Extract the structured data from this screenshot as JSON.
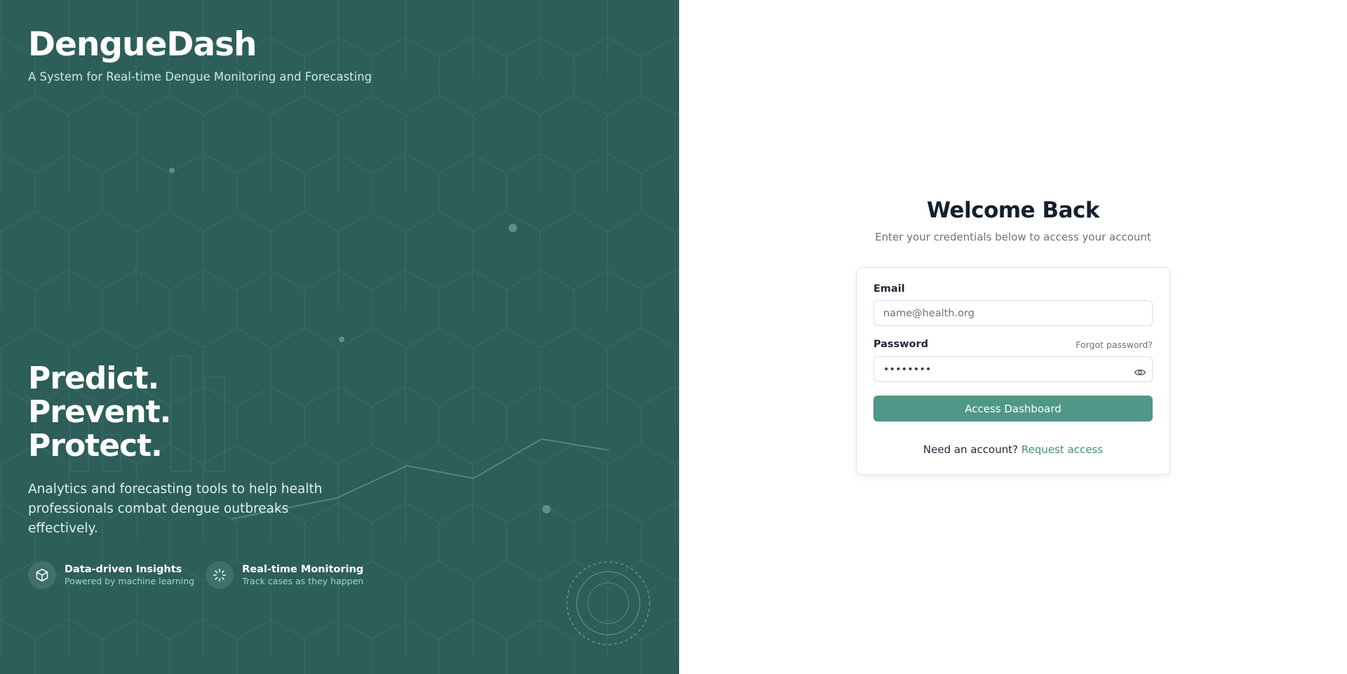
{
  "brand": {
    "title": "DengueDash",
    "subtitle": "A System for Real-time Dengue Monitoring and Forecasting"
  },
  "hero": {
    "lines": [
      "Predict.",
      "Prevent.",
      "Protect."
    ],
    "description": "Analytics and forecasting tools to help health professionals combat dengue outbreaks effectively."
  },
  "features": [
    {
      "icon": "cube-icon",
      "title": "Data-driven Insights",
      "subtitle": "Powered by machine learning"
    },
    {
      "icon": "loader-icon",
      "title": "Real-time Monitoring",
      "subtitle": "Track cases as they happen"
    }
  ],
  "login": {
    "title": "Welcome Back",
    "subtitle": "Enter your credentials below to access your account",
    "email_label": "Email",
    "email_placeholder": "name@health.org",
    "password_label": "Password",
    "password_value": "********",
    "forgot_label": "Forgot password?",
    "submit_label": "Access Dashboard",
    "footer_text": "Need an account?",
    "footer_link": "Request access"
  },
  "colors": {
    "panel_bg": "#2e5e59",
    "accent": "#4f9787",
    "link": "#3f8f7c",
    "feature_subtitle": "#8fe0cb"
  }
}
